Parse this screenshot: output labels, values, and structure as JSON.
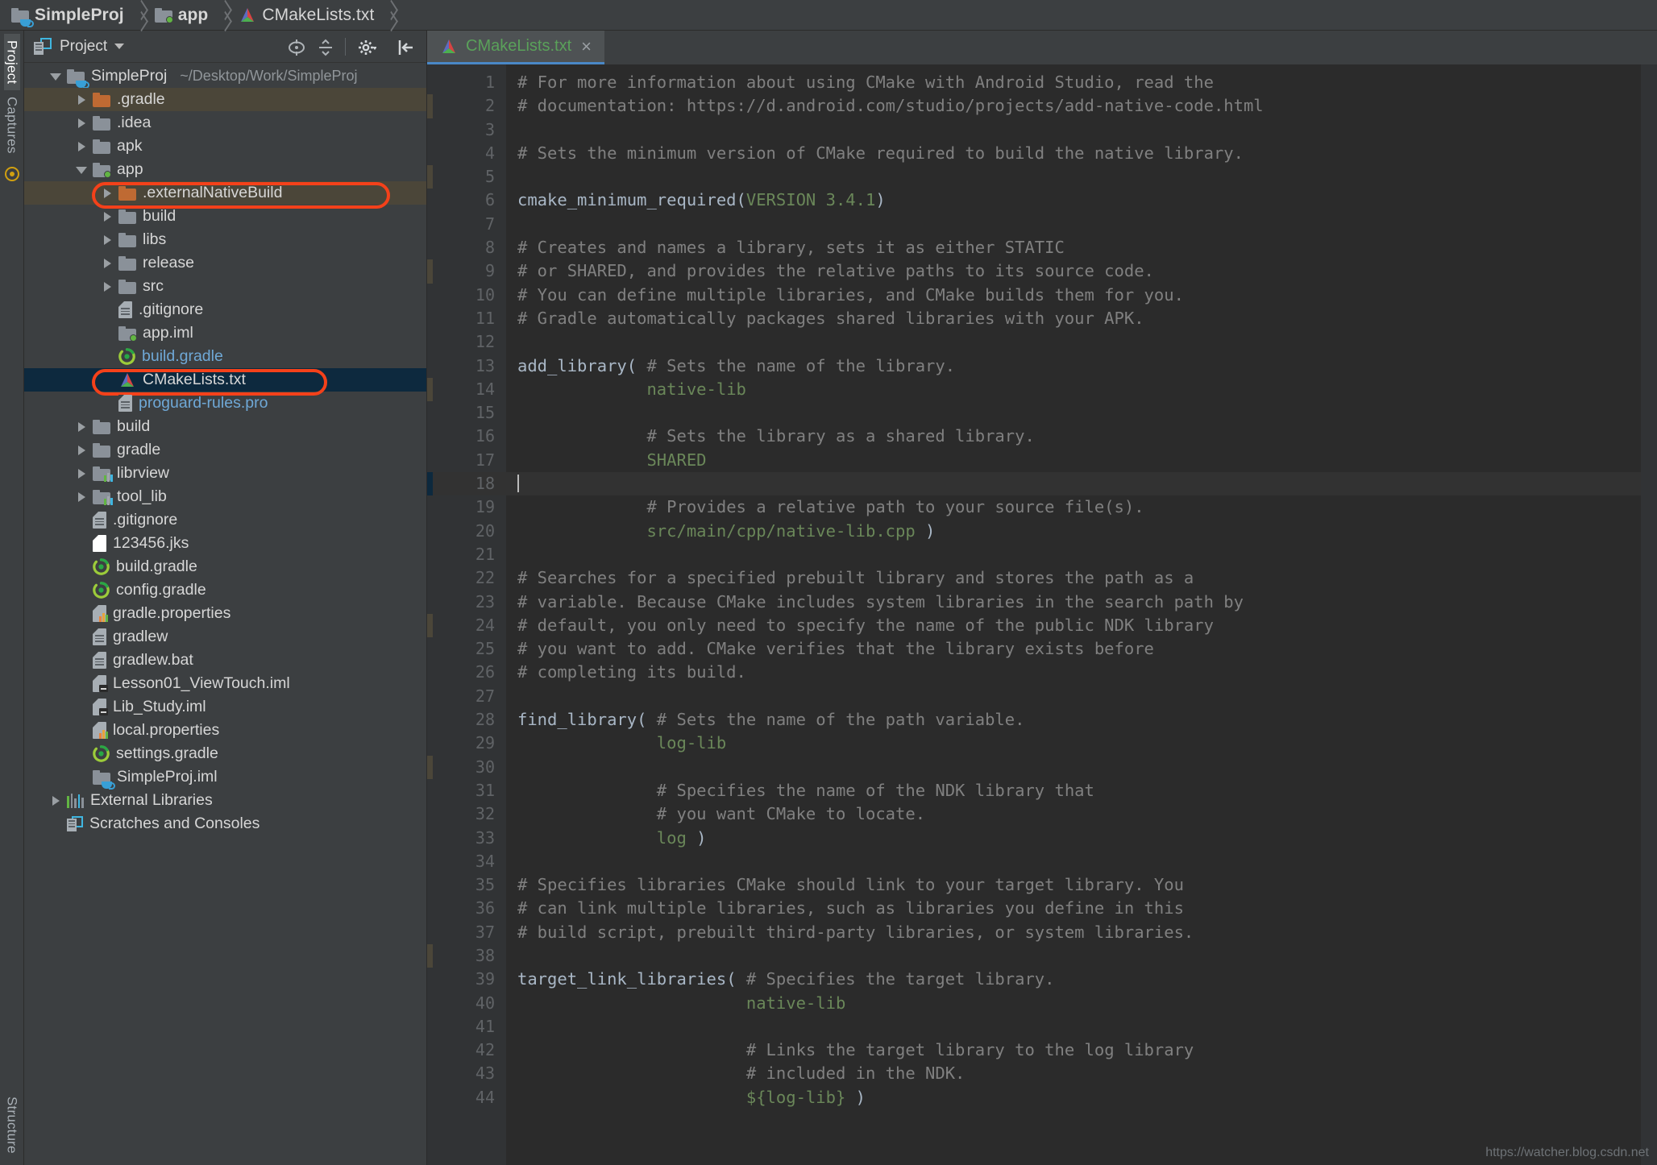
{
  "breadcrumb": {
    "items": [
      {
        "label": "SimpleProj",
        "icon": "module-folder-icon",
        "bold": true
      },
      {
        "label": "app",
        "icon": "module-folder-green-dot-icon",
        "bold": true
      },
      {
        "label": "CMakeLists.txt",
        "icon": "cmake-icon",
        "bold": false
      }
    ]
  },
  "left_strip": {
    "top_tabs": [
      "Project",
      "Captures"
    ],
    "bottom_tabs": [
      "Structure"
    ]
  },
  "panel": {
    "title": "Project",
    "tools": [
      "locate-icon",
      "collapse-all-icon",
      "gear-icon",
      "hide-icon"
    ]
  },
  "tree": {
    "items": [
      {
        "depth": 0,
        "arrow": "down",
        "icon": "module-folder-cup-icon",
        "label": "SimpleProj",
        "sub": "~/Desktop/Work/SimpleProj",
        "state": "normal"
      },
      {
        "depth": 1,
        "arrow": "right",
        "icon": "folder-orange-icon",
        "label": ".gradle",
        "sub": "",
        "state": "highlight"
      },
      {
        "depth": 1,
        "arrow": "right",
        "icon": "folder-icon",
        "label": ".idea",
        "sub": "",
        "state": "normal"
      },
      {
        "depth": 1,
        "arrow": "right",
        "icon": "folder-icon",
        "label": "apk",
        "sub": "",
        "state": "normal"
      },
      {
        "depth": 1,
        "arrow": "down",
        "icon": "module-folder-green-dot-icon",
        "label": "app",
        "sub": "",
        "state": "normal"
      },
      {
        "depth": 2,
        "arrow": "right",
        "icon": "folder-orange-icon",
        "label": ".externalNativeBuild",
        "sub": "",
        "state": "highlight",
        "ring": true
      },
      {
        "depth": 2,
        "arrow": "right",
        "icon": "folder-icon",
        "label": "build",
        "sub": "",
        "state": "normal"
      },
      {
        "depth": 2,
        "arrow": "right",
        "icon": "folder-icon",
        "label": "libs",
        "sub": "",
        "state": "normal"
      },
      {
        "depth": 2,
        "arrow": "right",
        "icon": "folder-icon",
        "label": "release",
        "sub": "",
        "state": "normal"
      },
      {
        "depth": 2,
        "arrow": "right",
        "icon": "folder-icon",
        "label": "src",
        "sub": "",
        "state": "normal"
      },
      {
        "depth": 2,
        "arrow": "none",
        "icon": "file-icon",
        "label": ".gitignore",
        "sub": "",
        "state": "normal"
      },
      {
        "depth": 2,
        "arrow": "none",
        "icon": "module-folder-green-dot-icon",
        "label": "app.iml",
        "sub": "",
        "state": "normal"
      },
      {
        "depth": 2,
        "arrow": "none",
        "icon": "gradle-icon",
        "label": "build.gradle",
        "sub": "",
        "state": "normal",
        "color": "blue"
      },
      {
        "depth": 2,
        "arrow": "none",
        "icon": "cmake-icon",
        "label": "CMakeLists.txt",
        "sub": "",
        "state": "selected",
        "ring": true
      },
      {
        "depth": 2,
        "arrow": "none",
        "icon": "file-icon",
        "label": "proguard-rules.pro",
        "sub": "",
        "state": "normal",
        "color": "blue"
      },
      {
        "depth": 1,
        "arrow": "right",
        "icon": "folder-icon",
        "label": "build",
        "sub": "",
        "state": "normal"
      },
      {
        "depth": 1,
        "arrow": "right",
        "icon": "folder-icon",
        "label": "gradle",
        "sub": "",
        "state": "normal"
      },
      {
        "depth": 1,
        "arrow": "right",
        "icon": "library-folder-icon",
        "label": "librview",
        "sub": "",
        "state": "normal"
      },
      {
        "depth": 1,
        "arrow": "right",
        "icon": "library-folder-icon",
        "label": "tool_lib",
        "sub": "",
        "state": "normal"
      },
      {
        "depth": 1,
        "arrow": "none",
        "icon": "file-icon",
        "label": ".gitignore",
        "sub": "",
        "state": "normal"
      },
      {
        "depth": 1,
        "arrow": "none",
        "icon": "blank-file-icon",
        "label": "123456.jks",
        "sub": "",
        "state": "normal"
      },
      {
        "depth": 1,
        "arrow": "none",
        "icon": "gradle-icon",
        "label": "build.gradle",
        "sub": "",
        "state": "normal"
      },
      {
        "depth": 1,
        "arrow": "none",
        "icon": "gradle-icon",
        "label": "config.gradle",
        "sub": "",
        "state": "normal"
      },
      {
        "depth": 1,
        "arrow": "none",
        "icon": "properties-file-icon",
        "label": "gradle.properties",
        "sub": "",
        "state": "normal"
      },
      {
        "depth": 1,
        "arrow": "none",
        "icon": "file-icon",
        "label": "gradlew",
        "sub": "",
        "state": "normal"
      },
      {
        "depth": 1,
        "arrow": "none",
        "icon": "file-icon",
        "label": "gradlew.bat",
        "sub": "",
        "state": "normal"
      },
      {
        "depth": 1,
        "arrow": "none",
        "icon": "iml-file-icon",
        "label": "Lesson01_ViewTouch.iml",
        "sub": "",
        "state": "normal"
      },
      {
        "depth": 1,
        "arrow": "none",
        "icon": "iml-file-icon",
        "label": "Lib_Study.iml",
        "sub": "",
        "state": "normal"
      },
      {
        "depth": 1,
        "arrow": "none",
        "icon": "properties-file-icon",
        "label": "local.properties",
        "sub": "",
        "state": "normal"
      },
      {
        "depth": 1,
        "arrow": "none",
        "icon": "gradle-icon",
        "label": "settings.gradle",
        "sub": "",
        "state": "normal"
      },
      {
        "depth": 1,
        "arrow": "none",
        "icon": "module-folder-cup-icon",
        "label": "SimpleProj.iml",
        "sub": "",
        "state": "normal"
      },
      {
        "depth": 0,
        "arrow": "right",
        "icon": "libraries-icon",
        "label": "External Libraries",
        "sub": "",
        "state": "normal"
      },
      {
        "depth": 0,
        "arrow": "none",
        "icon": "scratches-icon",
        "label": "Scratches and Consoles",
        "sub": "",
        "state": "normal"
      }
    ]
  },
  "editor": {
    "tab": {
      "label": "CMakeLists.txt",
      "icon": "cmake-icon",
      "close": "×"
    },
    "cursor_line": 18,
    "marked_lines": [
      2,
      5,
      9,
      14,
      24,
      30,
      38
    ],
    "lines": [
      {
        "n": 1,
        "html": "<span class='cm'># For more information about using CMake with Android Studio, read the</span>"
      },
      {
        "n": 2,
        "html": "<span class='cm'># documentation: https://d.android.com/studio/projects/add-native-code.html</span>"
      },
      {
        "n": 3,
        "html": ""
      },
      {
        "n": 4,
        "html": "<span class='cm'># Sets the minimum version of CMake required to build the native library.</span>"
      },
      {
        "n": 5,
        "html": ""
      },
      {
        "n": 6,
        "html": "<span class='kw'>cmake_minimum_required</span>(<span class='grn'>VERSION 3.4.1</span>)"
      },
      {
        "n": 7,
        "html": ""
      },
      {
        "n": 8,
        "html": "<span class='cm'># Creates and names a library, sets it as either STATIC</span>"
      },
      {
        "n": 9,
        "html": "<span class='cm'># or SHARED, and provides the relative paths to its source code.</span>"
      },
      {
        "n": 10,
        "html": "<span class='cm'># You can define multiple libraries, and CMake builds them for you.</span>"
      },
      {
        "n": 11,
        "html": "<span class='cm'># Gradle automatically packages shared libraries with your APK.</span>"
      },
      {
        "n": 12,
        "html": ""
      },
      {
        "n": 13,
        "html": "<span class='kw'>add_library</span>( <span class='cm'># Sets the name of the library.</span>"
      },
      {
        "n": 14,
        "html": "             <span class='grn'>native-lib</span>"
      },
      {
        "n": 15,
        "html": ""
      },
      {
        "n": 16,
        "html": "             <span class='cm'># Sets the library as a shared library.</span>"
      },
      {
        "n": 17,
        "html": "             <span class='grn'>SHARED</span>"
      },
      {
        "n": 18,
        "html": "<span class='caret'></span>"
      },
      {
        "n": 19,
        "html": "             <span class='cm'># Provides a relative path to your source file(s).</span>"
      },
      {
        "n": 20,
        "html": "             <span class='grn'>src/main/cpp/native-lib.cpp</span> )"
      },
      {
        "n": 21,
        "html": ""
      },
      {
        "n": 22,
        "html": "<span class='cm'># Searches for a specified prebuilt library and stores the path as a</span>"
      },
      {
        "n": 23,
        "html": "<span class='cm'># variable. Because CMake includes system libraries in the search path by</span>"
      },
      {
        "n": 24,
        "html": "<span class='cm'># default, you only need to specify the name of the public NDK library</span>"
      },
      {
        "n": 25,
        "html": "<span class='cm'># you want to add. CMake verifies that the library exists before</span>"
      },
      {
        "n": 26,
        "html": "<span class='cm'># completing its build.</span>"
      },
      {
        "n": 27,
        "html": ""
      },
      {
        "n": 28,
        "html": "<span class='kw'>find_library</span>( <span class='cm'># Sets the name of the path variable.</span>"
      },
      {
        "n": 29,
        "html": "              <span class='grn'>log-lib</span>"
      },
      {
        "n": 30,
        "html": ""
      },
      {
        "n": 31,
        "html": "              <span class='cm'># Specifies the name of the NDK library that</span>"
      },
      {
        "n": 32,
        "html": "              <span class='cm'># you want CMake to locate.</span>"
      },
      {
        "n": 33,
        "html": "              <span class='grn'>log</span> )"
      },
      {
        "n": 34,
        "html": ""
      },
      {
        "n": 35,
        "html": "<span class='cm'># Specifies libraries CMake should link to your target library. You</span>"
      },
      {
        "n": 36,
        "html": "<span class='cm'># can link multiple libraries, such as libraries you define in this</span>"
      },
      {
        "n": 37,
        "html": "<span class='cm'># build script, prebuilt third-party libraries, or system libraries.</span>"
      },
      {
        "n": 38,
        "html": ""
      },
      {
        "n": 39,
        "html": "<span class='kw'>target_link_libraries</span>( <span class='cm'># Specifies the target library.</span>"
      },
      {
        "n": 40,
        "html": "                       <span class='grn'>native-lib</span>"
      },
      {
        "n": 41,
        "html": ""
      },
      {
        "n": 42,
        "html": "                       <span class='cm'># Links the target library to the log library</span>"
      },
      {
        "n": 43,
        "html": "                       <span class='cm'># included in the NDK.</span>"
      },
      {
        "n": 44,
        "html": "                       <span class='grn'>${log-lib}</span> )"
      }
    ]
  },
  "watermark": "https://watcher.blog.csdn.net",
  "colors": {
    "background": "#3c3f41",
    "editor_bg": "#2b2b2b",
    "selection": "#0d293e",
    "highlight_row": "#4b4639",
    "ring": "#f4411a",
    "tab_underline": "#4a88c7",
    "comment": "#808080",
    "string_green": "#6a8759"
  }
}
